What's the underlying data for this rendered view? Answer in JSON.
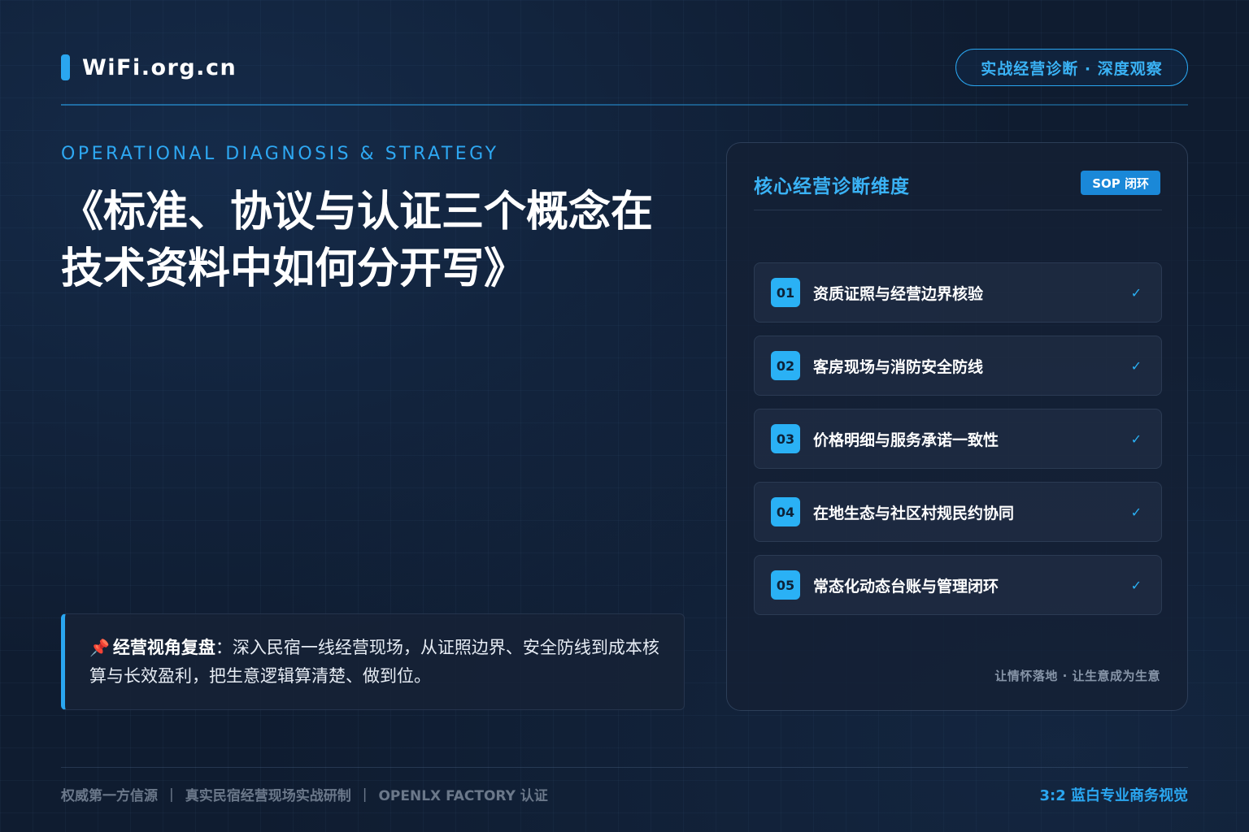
{
  "header": {
    "brand": "WiFi.org.cn",
    "badge": "实战经营诊断 · 深度观察"
  },
  "hero": {
    "kicker": "OPERATIONAL DIAGNOSIS & STRATEGY",
    "title_line1": "《标准、协议与认证三个概念在",
    "title_line2": "技术资料中如何分开写》"
  },
  "quote": {
    "pin_icon": "📌",
    "label": "经营视角复盘",
    "text": "：深入民宿一线经营现场，从证照边界、安全防线到成本核算与长效盈利，把生意逻辑算清楚、做到位。"
  },
  "card": {
    "title": "核心经营诊断维度",
    "tag": "SOP 闭环",
    "items": [
      {
        "num": "01",
        "label": "资质证照与经营边界核验",
        "check": "✓"
      },
      {
        "num": "02",
        "label": "客房现场与消防安全防线",
        "check": "✓"
      },
      {
        "num": "03",
        "label": "价格明细与服务承诺一致性",
        "check": "✓"
      },
      {
        "num": "04",
        "label": "在地生态与社区村规民约协同",
        "check": "✓"
      },
      {
        "num": "05",
        "label": "常态化动态台账与管理闭环",
        "check": "✓"
      }
    ],
    "footer": "让情怀落地 · 让生意成为生意"
  },
  "footer": {
    "item1": "权威第一方信源",
    "item2": "真实民宿经营现场实战研制",
    "item3": "OPENLX FACTORY 认证",
    "separator": "|",
    "right": "3:2 蓝白专业商务视觉"
  },
  "colors": {
    "accent": "#2aa6f0",
    "background": "#0f1c30",
    "card": "#14203a"
  }
}
